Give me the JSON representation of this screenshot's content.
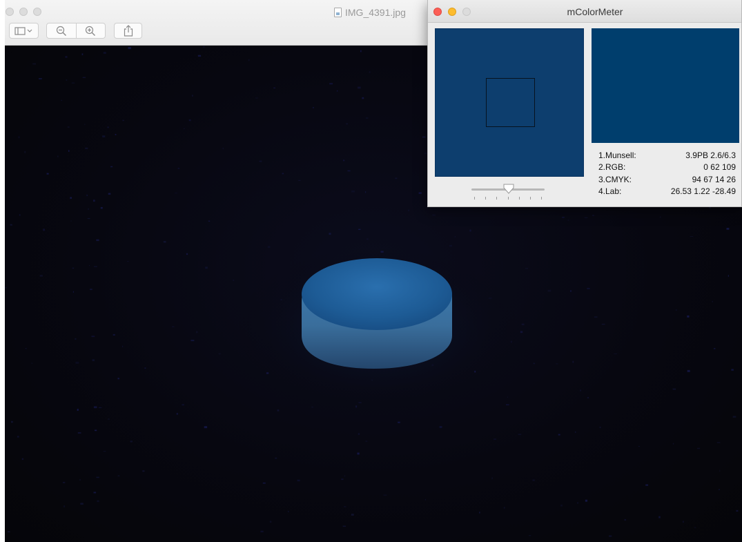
{
  "preview": {
    "document_title": "IMG_4391.jpg",
    "toolbar": {
      "sidebar_icon": "sidebar-icon",
      "zoom_out_icon": "zoom-out-icon",
      "zoom_in_icon": "zoom-in-icon",
      "share_icon": "share-icon"
    },
    "photo_subject": {
      "puck_color": "#1f5f9a"
    }
  },
  "color_meter": {
    "window_title": "mColorMeter",
    "magnifier_color": "#0d3e6e",
    "swatch_color": "#003e6d",
    "slider_value_fraction": 0.5,
    "readouts": [
      {
        "label": "1.Munsell:",
        "value": "3.9PB 2.6/6.3"
      },
      {
        "label": "2.RGB:",
        "value": "0 62 109"
      },
      {
        "label": "3.CMYK:",
        "value": "94 67 14 26"
      },
      {
        "label": "4.Lab:",
        "value": "26.53 1.22 -28.49"
      }
    ]
  }
}
